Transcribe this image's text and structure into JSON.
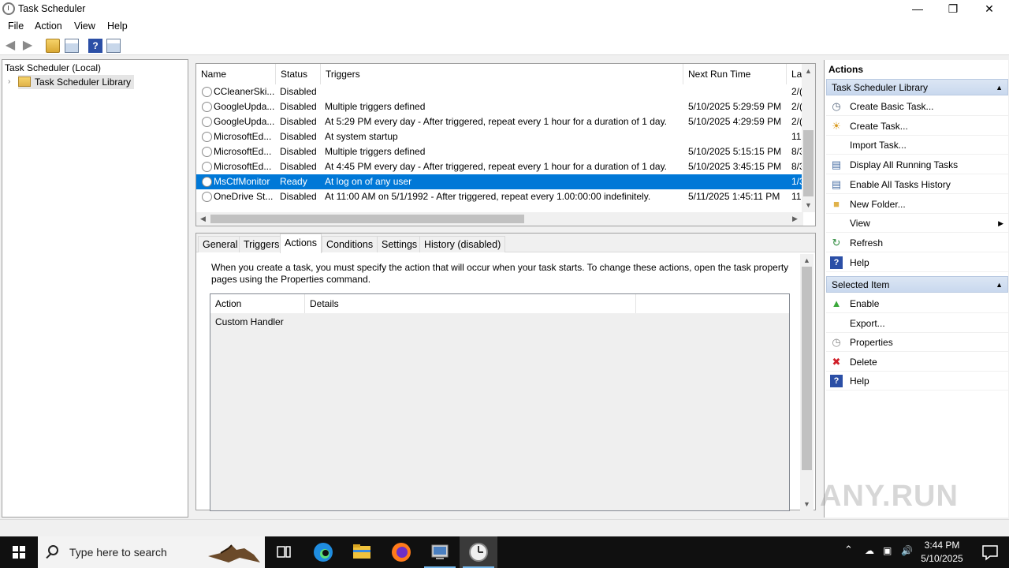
{
  "window": {
    "title": "Task Scheduler",
    "controls": {
      "minimize": "—",
      "restore": "❐",
      "close": "✕"
    }
  },
  "menu": [
    "File",
    "Action",
    "View",
    "Help"
  ],
  "tree": {
    "root": "Task Scheduler (Local)",
    "library": "Task Scheduler Library"
  },
  "task_list": {
    "columns": [
      "Name",
      "Status",
      "Triggers",
      "Next Run Time",
      "La"
    ],
    "rows": [
      {
        "name": "CCleanerSki...",
        "status": "Disabled",
        "triggers": "",
        "next": "",
        "last": "2/("
      },
      {
        "name": "GoogleUpda...",
        "status": "Disabled",
        "triggers": "Multiple triggers defined",
        "next": "5/10/2025 5:29:59 PM",
        "last": "2/("
      },
      {
        "name": "GoogleUpda...",
        "status": "Disabled",
        "triggers": "At 5:29 PM every day - After triggered, repeat every 1 hour for a duration of 1 day.",
        "next": "5/10/2025 4:29:59 PM",
        "last": "2/("
      },
      {
        "name": "MicrosoftEd...",
        "status": "Disabled",
        "triggers": "At system startup",
        "next": "",
        "last": "11,"
      },
      {
        "name": "MicrosoftEd...",
        "status": "Disabled",
        "triggers": "Multiple triggers defined",
        "next": "5/10/2025 5:15:15 PM",
        "last": "8/3"
      },
      {
        "name": "MicrosoftEd...",
        "status": "Disabled",
        "triggers": "At 4:45 PM every day - After triggered, repeat every 1 hour for a duration of 1 day.",
        "next": "5/10/2025 3:45:15 PM",
        "last": "8/3"
      },
      {
        "name": "MsCtfMonitor",
        "status": "Ready",
        "triggers": "At log on of any user",
        "next": "",
        "last": "1/3"
      },
      {
        "name": "OneDrive St...",
        "status": "Disabled",
        "triggers": "At 11:00 AM on 5/1/1992 - After triggered, repeat every 1.00:00:00 indefinitely.",
        "next": "5/11/2025 1:45:11 PM",
        "last": "11,"
      }
    ]
  },
  "details": {
    "tabs": [
      "General",
      "Triggers",
      "Actions",
      "Conditions",
      "Settings",
      "History (disabled)"
    ],
    "active_tab": "Actions",
    "description": "When you create a task, you must specify the action that will occur when your task starts.  To change these actions, open the task property pages using the Properties command.",
    "columns": [
      "Action",
      "Details"
    ],
    "rows": [
      {
        "action": "Custom Handler",
        "details": ""
      }
    ]
  },
  "actions_pane": {
    "title": "Actions",
    "section1": "Task Scheduler Library",
    "section1_items": [
      {
        "label": "Create Basic Task...",
        "icon": "create-basic-task-icon"
      },
      {
        "label": "Create Task...",
        "icon": "create-task-icon"
      },
      {
        "label": "Import Task...",
        "icon": ""
      },
      {
        "label": "Display All Running Tasks",
        "icon": "running-tasks-icon"
      },
      {
        "label": "Enable All Tasks History",
        "icon": "history-icon"
      },
      {
        "label": "New Folder...",
        "icon": "folder-icon"
      },
      {
        "label": "View",
        "icon": ""
      },
      {
        "label": "Refresh",
        "icon": "refresh-icon"
      },
      {
        "label": "Help",
        "icon": "help-icon"
      }
    ],
    "section2": "Selected Item",
    "section2_items": [
      {
        "label": "Enable",
        "icon": "enable-icon"
      },
      {
        "label": "Export...",
        "icon": ""
      },
      {
        "label": "Properties",
        "icon": "properties-icon"
      },
      {
        "label": "Delete",
        "icon": "delete-icon"
      },
      {
        "label": "Help",
        "icon": "help-icon"
      }
    ]
  },
  "taskbar": {
    "search_placeholder": "Type here to search",
    "time": "3:44 PM",
    "date": "5/10/2025"
  },
  "watermark": "ANY.RUN"
}
